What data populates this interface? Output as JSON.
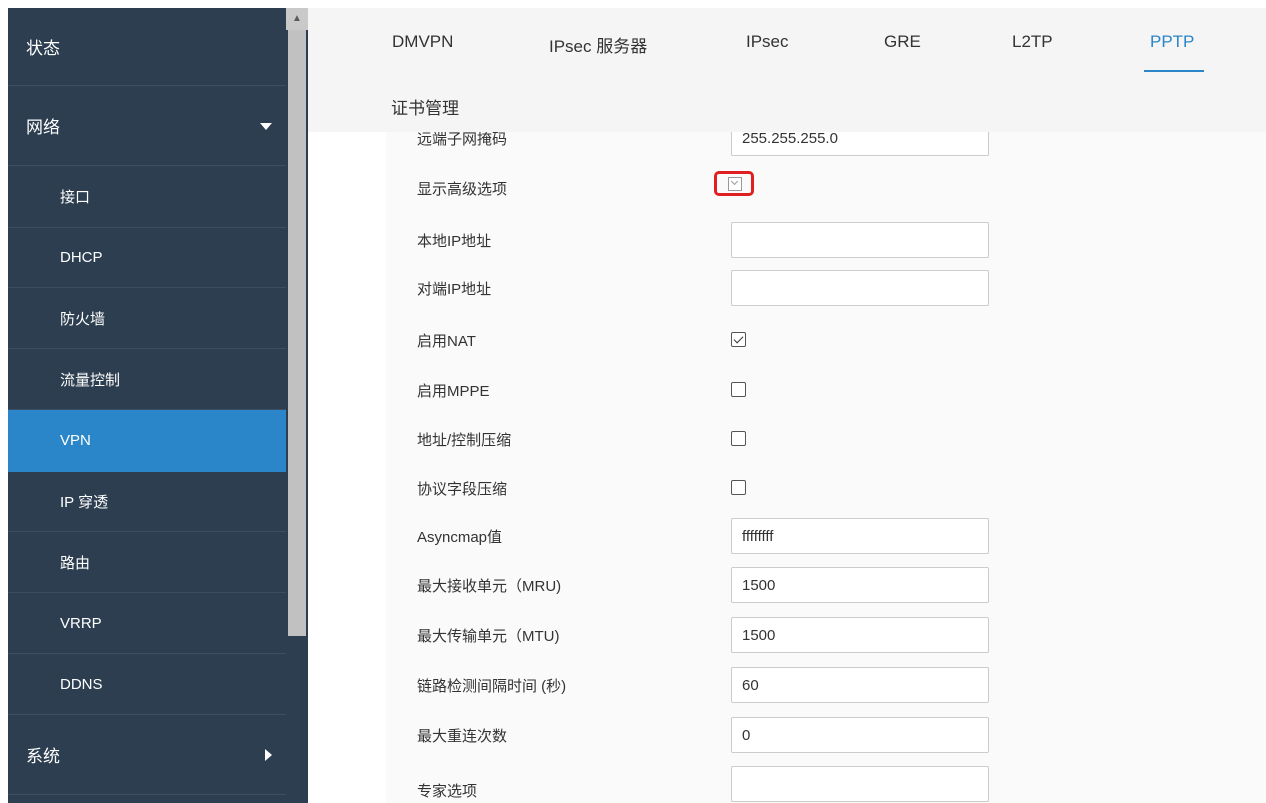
{
  "sidebar": {
    "items": [
      {
        "label": "状态",
        "level": "top",
        "active": false,
        "caret": ""
      },
      {
        "label": "网络",
        "level": "top",
        "active": false,
        "caret": "chevron-down"
      },
      {
        "label": "接口",
        "level": "sub",
        "active": false,
        "caret": ""
      },
      {
        "label": "DHCP",
        "level": "sub",
        "active": false,
        "caret": ""
      },
      {
        "label": "防火墙",
        "level": "sub",
        "active": false,
        "caret": ""
      },
      {
        "label": "流量控制",
        "level": "sub",
        "active": false,
        "caret": ""
      },
      {
        "label": "VPN",
        "level": "sub",
        "active": true,
        "caret": ""
      },
      {
        "label": "IP 穿透",
        "level": "sub",
        "active": false,
        "caret": ""
      },
      {
        "label": "路由",
        "level": "sub",
        "active": false,
        "caret": ""
      },
      {
        "label": "VRRP",
        "level": "sub",
        "active": false,
        "caret": ""
      },
      {
        "label": "DDNS",
        "level": "sub",
        "active": false,
        "caret": ""
      },
      {
        "label": "系统",
        "level": "top",
        "active": false,
        "caret": "chevron-right"
      }
    ]
  },
  "tabs": {
    "items": [
      {
        "label": "DMVPN",
        "active": false
      },
      {
        "label": "IPsec 服务器",
        "active": false
      },
      {
        "label": "IPsec",
        "active": false
      },
      {
        "label": "GRE",
        "active": false
      },
      {
        "label": "L2TP",
        "active": false
      },
      {
        "label": "PPTP",
        "active": true
      }
    ],
    "second_row": "证书管理"
  },
  "form": {
    "remote_subnet_mask": {
      "label": "远端子网掩码",
      "value": "255.255.255.0"
    },
    "show_advanced": {
      "label": "显示高级选项",
      "checked": true
    },
    "local_ip": {
      "label": "本地IP地址",
      "value": ""
    },
    "peer_ip": {
      "label": "对端IP地址",
      "value": ""
    },
    "enable_nat": {
      "label": "启用NAT",
      "checked": true
    },
    "enable_mppe": {
      "label": "启用MPPE",
      "checked": false
    },
    "addr_ctrl_compress": {
      "label": "地址/控制压缩",
      "checked": false
    },
    "protocol_field_compress": {
      "label": "协议字段压缩",
      "checked": false
    },
    "asyncmap": {
      "label": "Asyncmap值",
      "value": "ffffffff"
    },
    "mru": {
      "label": "最大接收单元（MRU)",
      "value": "1500"
    },
    "mtu": {
      "label": "最大传输单元（MTU)",
      "value": "1500"
    },
    "link_detect_interval": {
      "label": "链路检测间隔时间 (秒)",
      "value": "60"
    },
    "max_reconnect": {
      "label": "最大重连次数",
      "value": "0"
    },
    "expert_options": {
      "label": "专家选项",
      "value": ""
    }
  },
  "colors": {
    "sidebar_bg": "#2c3e50",
    "accent": "#2a86c8",
    "highlight": "#e02020"
  }
}
